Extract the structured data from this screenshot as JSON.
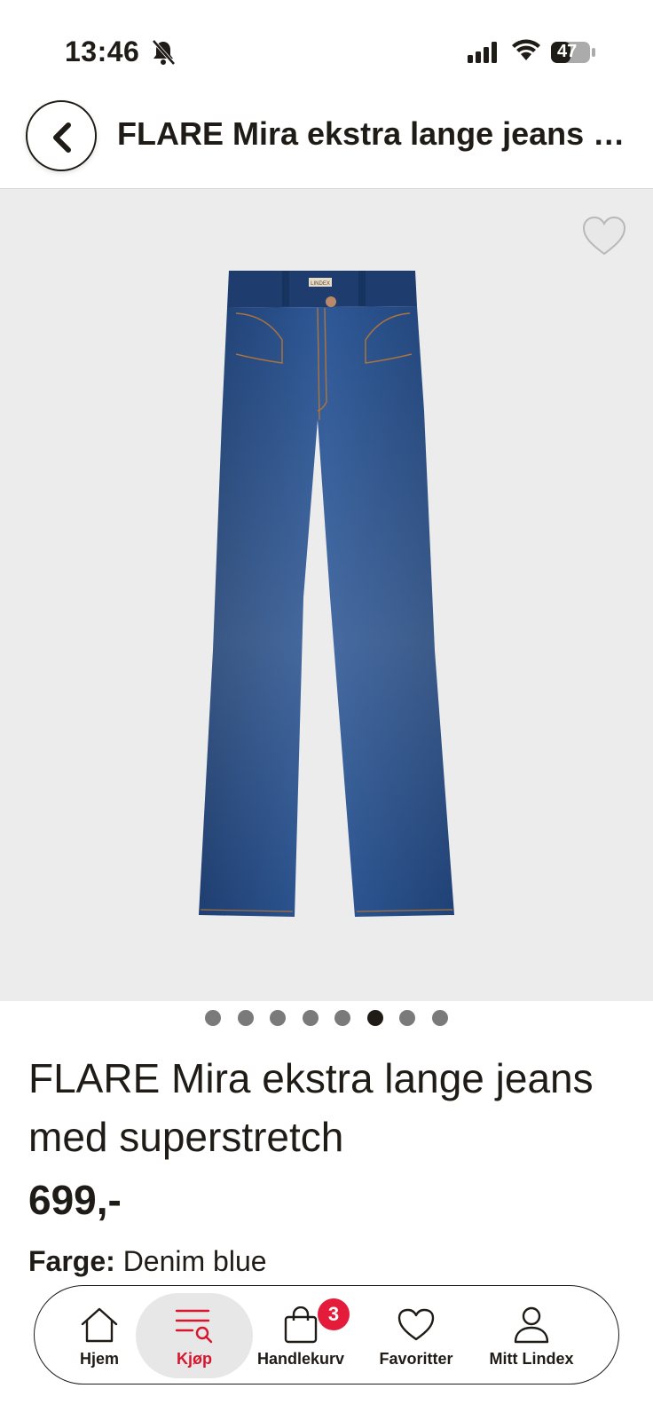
{
  "status_bar": {
    "time": "13:46",
    "battery": "47"
  },
  "header": {
    "title": "FLARE Mira ekstra lange jeans med superstretch"
  },
  "product_image": {
    "logo": "LINDEX"
  },
  "carousel": {
    "count": 8,
    "active_index": 5
  },
  "product": {
    "name": "FLARE Mira ekstra lange jeans med superstretch",
    "price": "699,-",
    "color_label": "Farge:",
    "color_value": "Denim blue"
  },
  "tabbar": {
    "items": [
      {
        "label": "Hjem",
        "icon": "home-icon"
      },
      {
        "label": "Kjøp",
        "icon": "shop-search-icon"
      },
      {
        "label": "Handlekurv",
        "icon": "cart-bag-icon"
      },
      {
        "label": "Favoritter",
        "icon": "heart-icon"
      },
      {
        "label": "Mitt Lindex",
        "icon": "profile-icon"
      }
    ],
    "cart_badge": "3"
  },
  "colors": {
    "accent": "#d8152d",
    "badge": "#e41b3a",
    "text": "#1f1b16"
  }
}
